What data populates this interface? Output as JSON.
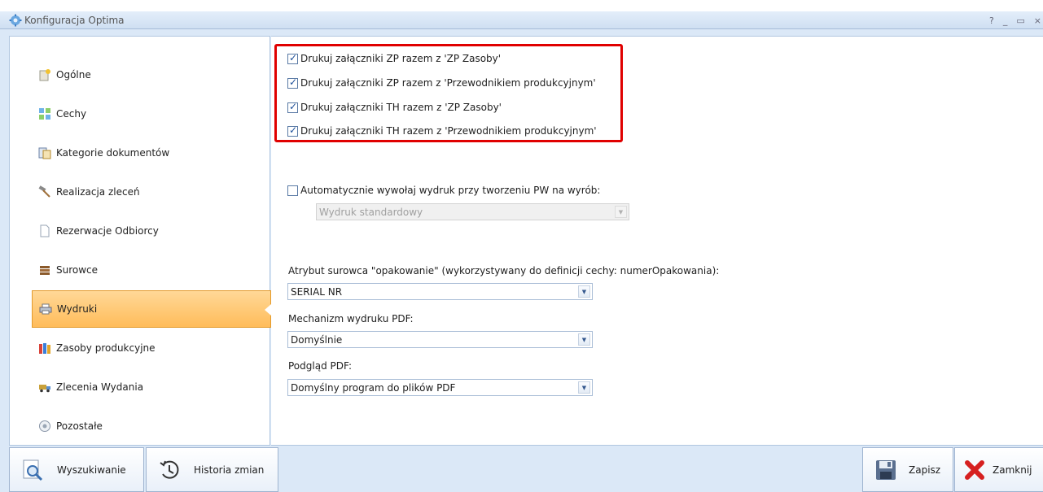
{
  "window": {
    "title": "Konfiguracja Optima",
    "controls": [
      "?",
      "_",
      "▭",
      "×"
    ]
  },
  "sidebar": {
    "items": [
      {
        "label": "Ogólne",
        "icon": "general-icon"
      },
      {
        "label": "Cechy",
        "icon": "features-icon"
      },
      {
        "label": "Kategorie dokumentów",
        "icon": "document-categories-icon"
      },
      {
        "label": "Realizacja zleceń",
        "icon": "hammer-icon"
      },
      {
        "label": "Rezerwacje Odbiorcy",
        "icon": "page-icon"
      },
      {
        "label": "Surowce",
        "icon": "materials-icon"
      },
      {
        "label": "Wydruki",
        "icon": "printer-icon",
        "active": true
      },
      {
        "label": "Zasoby produkcyjne",
        "icon": "books-icon"
      },
      {
        "label": "Zlecenia Wydania",
        "icon": "truck-icon"
      },
      {
        "label": "Pozostałe",
        "icon": "other-icon"
      }
    ]
  },
  "checkboxes": [
    {
      "label": "Drukuj załączniki ZP razem z 'ZP Zasoby'",
      "checked": true
    },
    {
      "label": "Drukuj załączniki ZP razem z 'Przewodnikiem produkcyjnym'",
      "checked": true
    },
    {
      "label": "Drukuj załączniki TH razem z 'ZP Zasoby'",
      "checked": true
    },
    {
      "label": "Drukuj załączniki TH razem z 'Przewodnikiem produkcyjnym'",
      "checked": true
    }
  ],
  "auto_print": {
    "label": "Automatycznie wywołaj wydruk przy tworzeniu PW na wyrób:",
    "checked": false,
    "select_value": "Wydruk standardowy"
  },
  "attribute": {
    "label": "Atrybut surowca \"opakowanie\" (wykorzystywany do definicji cechy: numerOpakowania):",
    "value": "SERIAL NR"
  },
  "pdf_mechanism": {
    "label": "Mechanizm wydruku PDF:",
    "value": "Domyślnie"
  },
  "pdf_preview": {
    "label": "Podgląd PDF:",
    "value": "Domyślny program do plików PDF"
  },
  "bottom": {
    "search_label": "Wyszukiwanie",
    "history_label": "Historia zmian",
    "save_label": "Zapisz",
    "close_label": "Zamknij"
  },
  "colors": {
    "highlight_box": "#e00000",
    "active_item": "#ffc46a",
    "frame": "#dbe8f7"
  }
}
